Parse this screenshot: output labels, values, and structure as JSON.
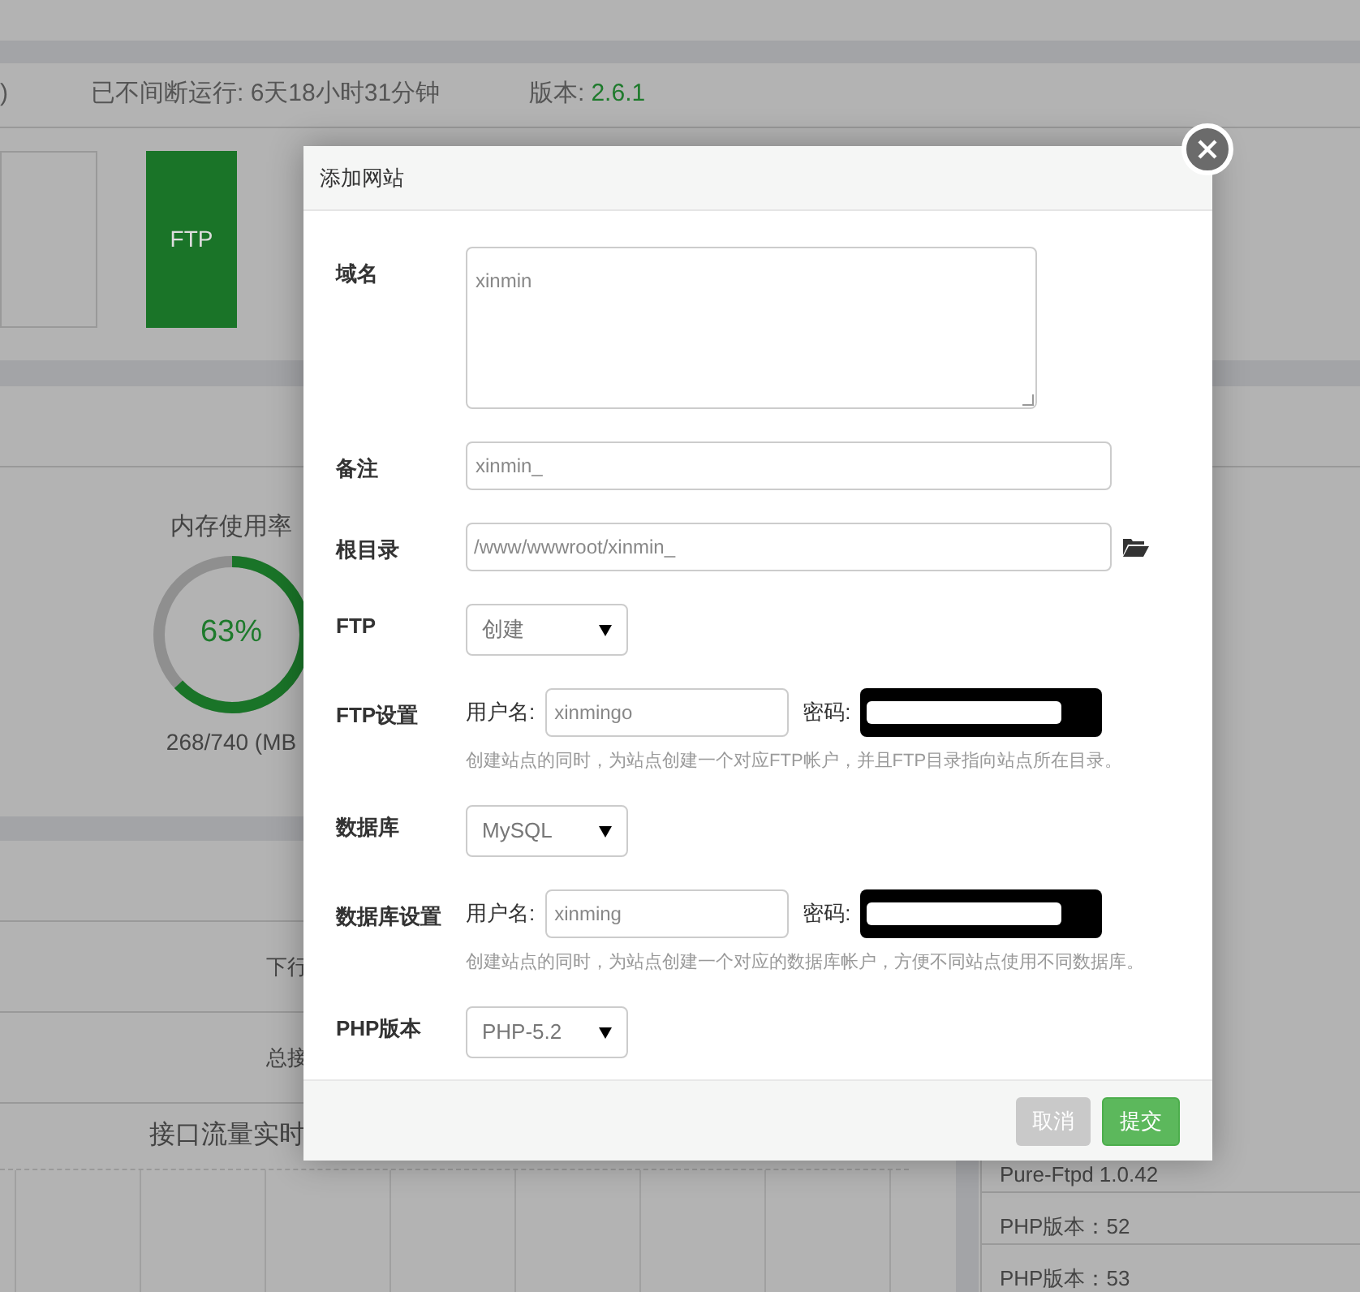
{
  "status_bar": {
    "paren": ")",
    "uptime": "已不间断运行: 6天18小时31分钟",
    "version_label": "版本:",
    "version": "2.6.1"
  },
  "tiles": [
    {
      "selected": false
    },
    {
      "label": "FTP",
      "selected": true
    }
  ],
  "memory": {
    "title": "内存使用率",
    "percent": "63%",
    "level": 0.63,
    "usage": "268/740 (MB"
  },
  "traffic": {
    "rows": [
      "下行",
      "总接"
    ],
    "title": "接口流量实时"
  },
  "software_list": [
    "Pure-Ftpd 1.0.42",
    "PHP版本：52",
    "PHP版本：53"
  ],
  "dialog": {
    "title": "添加网站",
    "domain": {
      "label": "域名",
      "value": "xinmin"
    },
    "note": {
      "label": "备注",
      "value": "xinmin_"
    },
    "root": {
      "label": "根目录",
      "value": "/www/wwwroot/xinmin_"
    },
    "ftp": {
      "label": "FTP",
      "value": "创建"
    },
    "ftp_settings": {
      "label": "FTP设置",
      "user_label": "用户名:",
      "user": "xinmingo",
      "password_label": "密码:",
      "hint": "创建站点的同时，为站点创建一个对应FTP帐户，并且FTP目录指向站点所在目录。"
    },
    "database": {
      "label": "数据库",
      "value": "MySQL"
    },
    "database_settings": {
      "label": "数据库设置",
      "user_label": "用户名:",
      "user": "xinming",
      "password_label": "密码:",
      "hint": "创建站点的同时，为站点创建一个对应的数据库帐户，方便不同站点使用不同数据库。"
    },
    "php": {
      "label": "PHP版本",
      "value": "PHP-5.2"
    },
    "buttons": [
      {
        "label": "取消",
        "kind": "cancel"
      },
      {
        "label": "提交",
        "kind": "submit"
      }
    ]
  }
}
